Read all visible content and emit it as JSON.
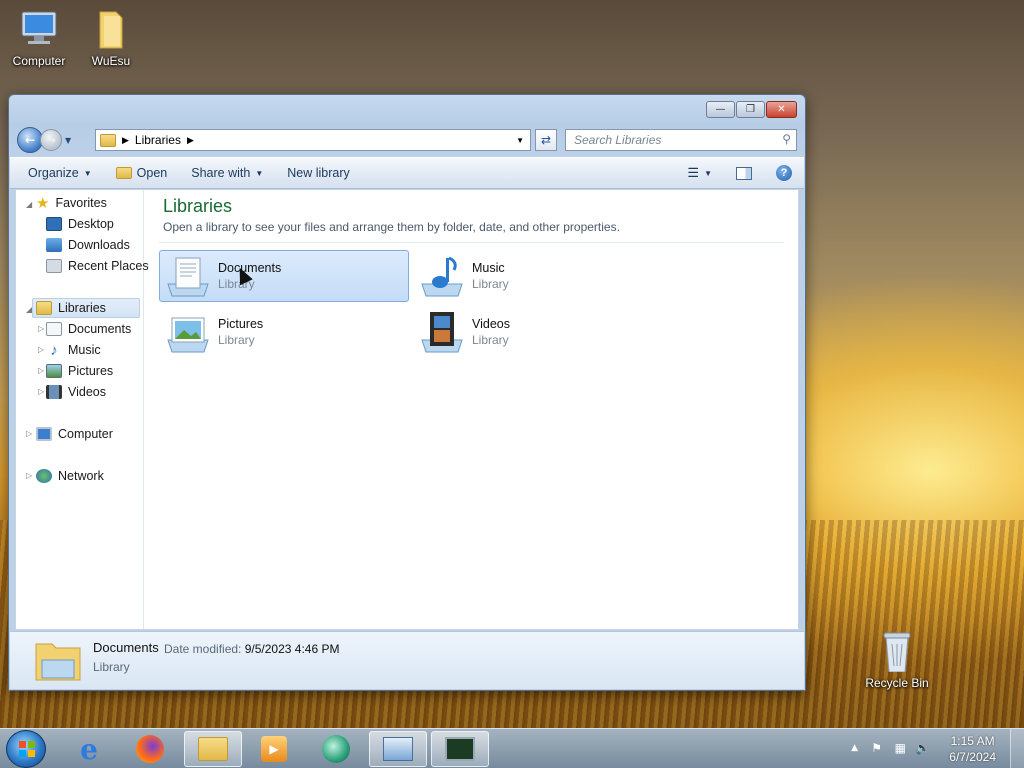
{
  "desktop": {
    "icons": [
      {
        "label": "Computer"
      },
      {
        "label": "WuEsu"
      },
      {
        "label": "Recycle Bin"
      }
    ]
  },
  "window": {
    "address_path": "Libraries",
    "search_placeholder": "Search Libraries",
    "toolbar": {
      "organize": "Organize",
      "open": "Open",
      "share_with": "Share with",
      "new_library": "New library"
    },
    "navpane": {
      "favorites": "Favorites",
      "favorites_items": [
        "Desktop",
        "Downloads",
        "Recent Places"
      ],
      "libraries": "Libraries",
      "libraries_items": [
        "Documents",
        "Music",
        "Pictures",
        "Videos"
      ],
      "computer": "Computer",
      "network": "Network"
    },
    "main": {
      "title": "Libraries",
      "subtitle": "Open a library to see your files and arrange them by folder, date, and other properties.",
      "libraries": [
        {
          "name": "Documents",
          "type": "Library"
        },
        {
          "name": "Music",
          "type": "Library"
        },
        {
          "name": "Pictures",
          "type": "Library"
        },
        {
          "name": "Videos",
          "type": "Library"
        }
      ]
    },
    "details": {
      "name": "Documents",
      "modified_label": "Date modified:",
      "modified_value": "9/5/2023 4:46 PM",
      "type": "Library"
    }
  },
  "taskbar": {
    "time": "1:15 AM",
    "date": "6/7/2024"
  },
  "colors": {
    "title_green": "#1a6b32",
    "selection": "#c4dcf7",
    "toolbar_text": "#1e395b"
  }
}
